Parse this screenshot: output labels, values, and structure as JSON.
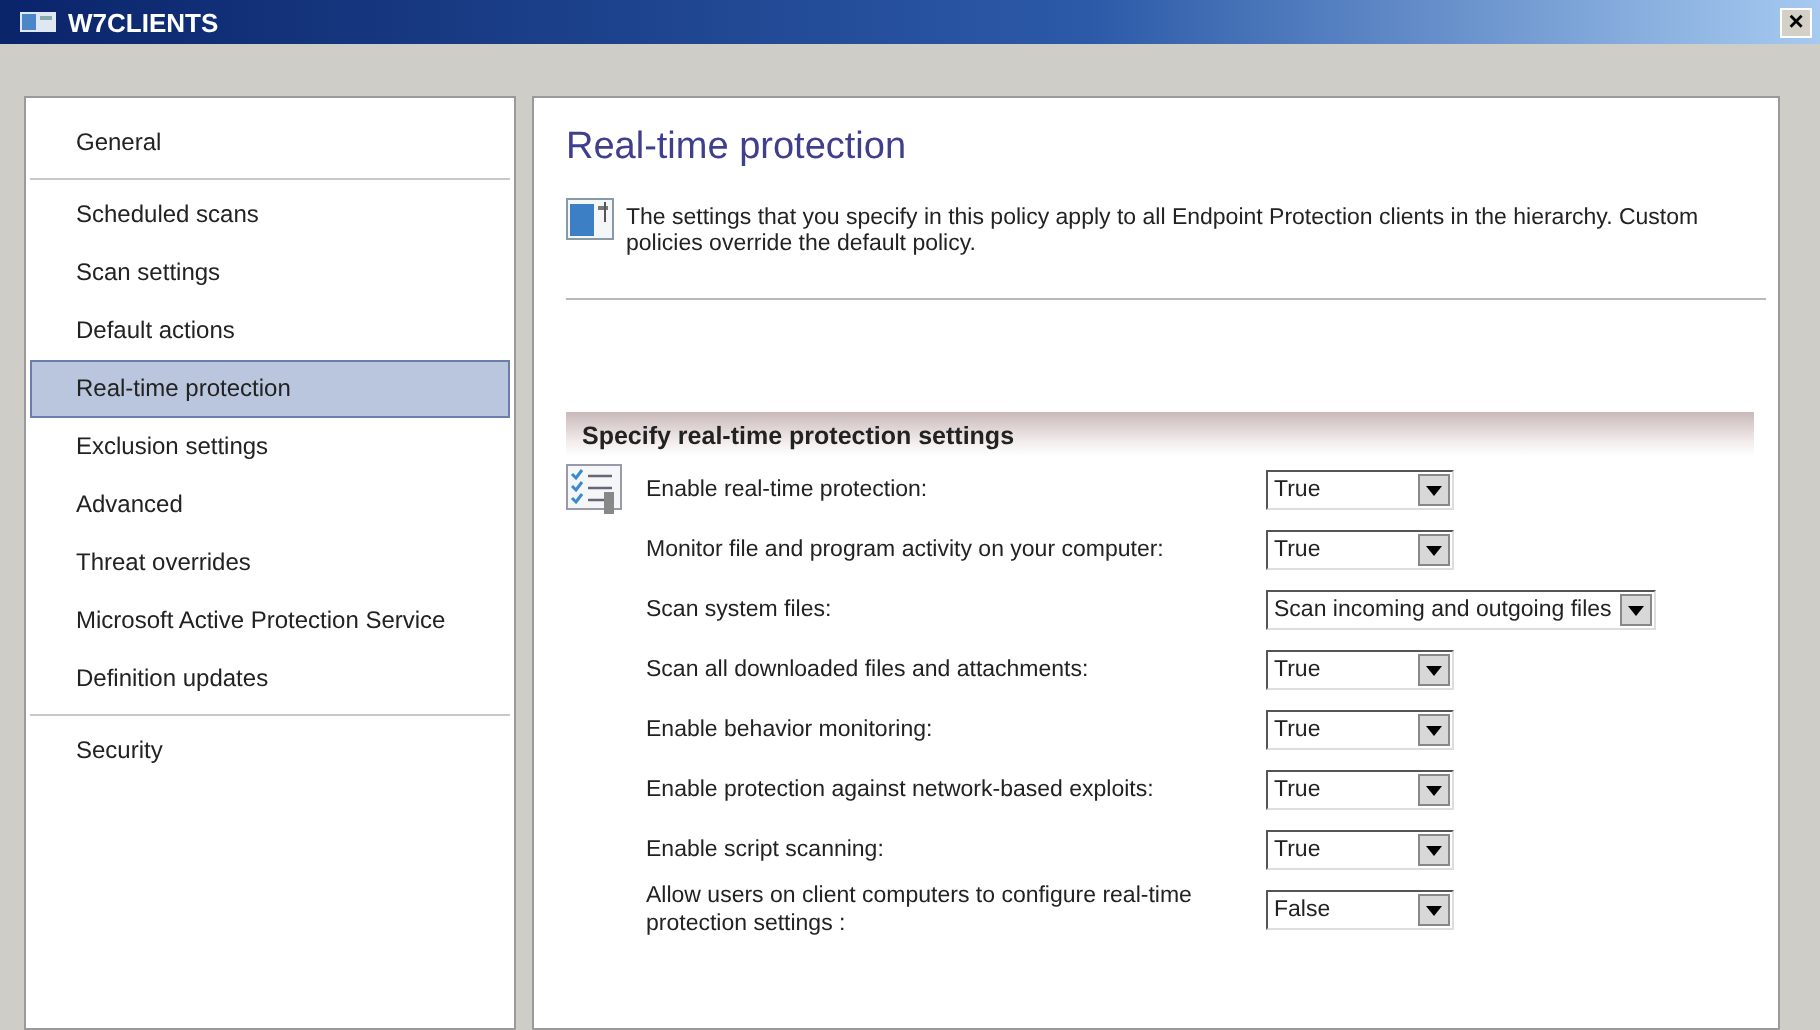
{
  "window": {
    "title": "W7CLIENTS",
    "close": "×"
  },
  "sidebar": {
    "groups": [
      [
        {
          "label": "General",
          "selected": false
        }
      ],
      [
        {
          "label": "Scheduled scans",
          "selected": false
        },
        {
          "label": "Scan settings",
          "selected": false
        },
        {
          "label": "Default actions",
          "selected": false
        },
        {
          "label": "Real-time protection",
          "selected": true
        },
        {
          "label": "Exclusion settings",
          "selected": false
        },
        {
          "label": "Advanced",
          "selected": false
        },
        {
          "label": "Threat overrides",
          "selected": false
        },
        {
          "label": "Microsoft Active Protection Service",
          "selected": false
        },
        {
          "label": "Definition updates",
          "selected": false
        }
      ],
      [
        {
          "label": "Security",
          "selected": false
        }
      ]
    ]
  },
  "page": {
    "title": "Real-time protection",
    "description": "The settings that you specify in this policy apply to all Endpoint Protection clients in the hierarchy. Custom policies override the default policy.",
    "section": {
      "title": "Specify real-time protection settings",
      "settings": [
        {
          "label": "Enable real-time protection:",
          "value": "True"
        },
        {
          "label": "Monitor file and program activity on your computer:",
          "value": "True"
        },
        {
          "label": "Scan system files:",
          "value": "Scan incoming and outgoing files"
        },
        {
          "label": "Scan all downloaded files and attachments:",
          "value": "True"
        },
        {
          "label": "Enable behavior monitoring:",
          "value": "True"
        },
        {
          "label": "Enable protection against network-based exploits:",
          "value": "True"
        },
        {
          "label": "Enable script scanning:",
          "value": "True"
        },
        {
          "label": "Allow users on client computers to configure real-time protection settings :",
          "value": "False"
        }
      ]
    }
  }
}
